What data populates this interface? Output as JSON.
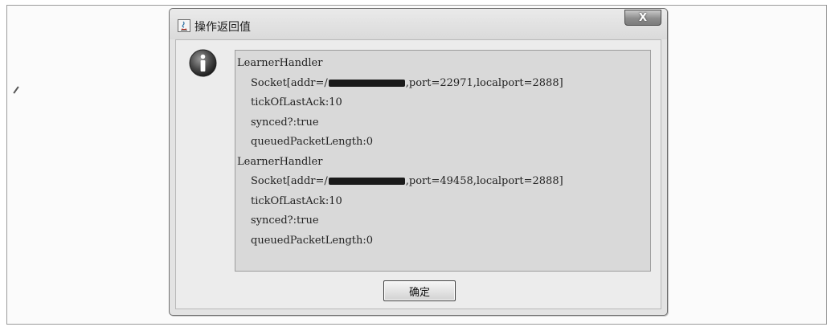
{
  "dialog": {
    "title": "操作返回值",
    "close_label": "X",
    "icon": "info-icon",
    "ok_label": "确定"
  },
  "message": {
    "lines": [
      {
        "text": "LearnerHandler"
      },
      {
        "prefix": "Socket[addr=/",
        "suffix": ",port=22971,localport=2888]"
      },
      {
        "text": "tickOfLastAck:10"
      },
      {
        "text": "synced?:true"
      },
      {
        "text": "queuedPacketLength:0"
      },
      {
        "text": "LearnerHandler"
      },
      {
        "prefix": "Socket[addr=/",
        "suffix": ",port=49458,localport=2888]"
      },
      {
        "text": "tickOfLastAck:10"
      },
      {
        "text": "synced?:true"
      },
      {
        "text": "queuedPacketLength:0"
      }
    ]
  }
}
